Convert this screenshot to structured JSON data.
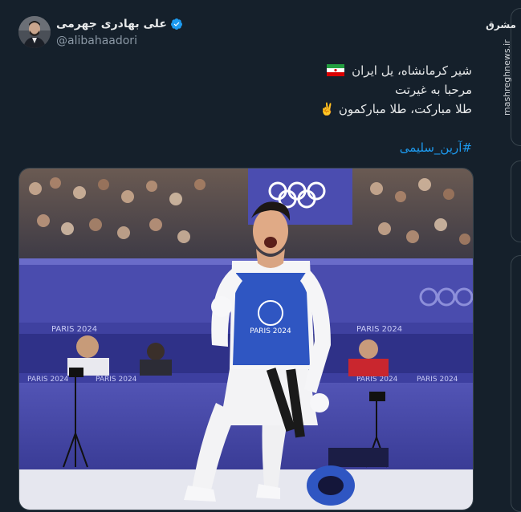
{
  "author": {
    "display_name": "علی بهادری جهرمی",
    "handle": "@alibahaadori",
    "verified": true
  },
  "tweet": {
    "lines": [
      "شیر کرمانشاه، یل ایران",
      "مرحبا به غیرتت",
      "طلا مبارکت، طلا مبارکمون ✌️"
    ],
    "hashtag": "#آرین_سلیمی"
  },
  "photo": {
    "banner_text": "PARIS 2024",
    "vest_text": "PARIS 2024"
  },
  "watermark": {
    "logo": "مشرق",
    "site": "mashreghnews.ir"
  },
  "colors": {
    "background": "#15202b",
    "accent": "#1d9bf0",
    "arena_purple": "#3b3f9c"
  }
}
